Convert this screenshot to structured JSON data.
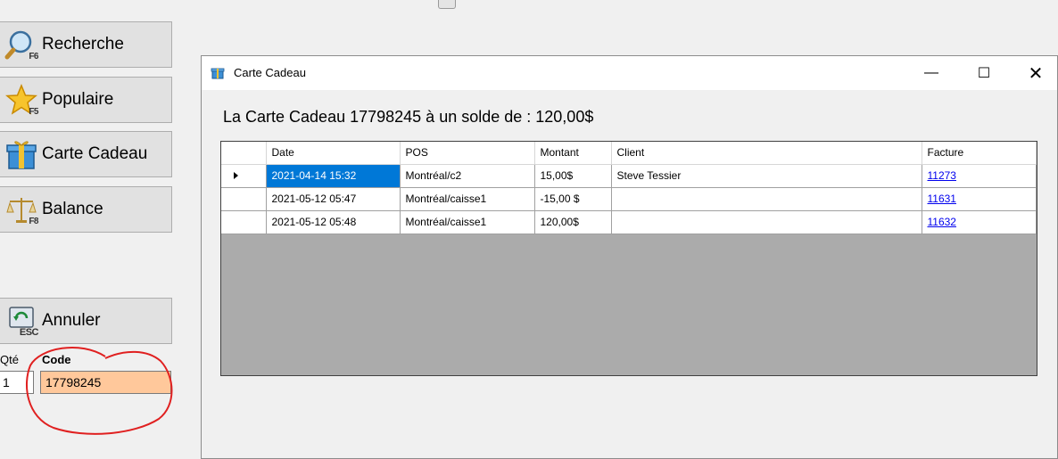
{
  "sidebar": {
    "buttons": [
      {
        "label": "Recherche",
        "key": "F6",
        "icon": "magnifier-icon"
      },
      {
        "label": "Populaire",
        "key": "F5",
        "icon": "star-icon"
      },
      {
        "label": "Carte Cadeau",
        "key": "",
        "icon": "gift-icon"
      },
      {
        "label": "Balance",
        "key": "F8",
        "icon": "scale-icon"
      },
      {
        "label": "Annuler",
        "key": "ESC",
        "icon": "cancel-icon"
      }
    ],
    "qty_label": "Qté",
    "qty_value": "1",
    "code_label": "Code",
    "code_value": "17798245"
  },
  "dialog": {
    "title": "Carte Cadeau",
    "controls": {
      "minimize": "—",
      "maximize": "☐",
      "close": "✕"
    },
    "balance_text": "La Carte Cadeau 17798245 à un solde de : 120,00$",
    "columns": [
      "Date",
      "POS",
      "Montant",
      "Client",
      "Facture"
    ],
    "rows": [
      {
        "date": "2021-04-14 15:32",
        "pos": "Montréal/c2",
        "montant": "15,00$",
        "client": "Steve Tessier",
        "facture": "11273"
      },
      {
        "date": "2021-05-12 05:47",
        "pos": "Montréal/caisse1",
        "montant": "-15,00 $",
        "client": "",
        "facture": "11631"
      },
      {
        "date": "2021-05-12 05:48",
        "pos": "Montréal/caisse1",
        "montant": "120,00$",
        "client": "",
        "facture": "11632"
      }
    ]
  },
  "colors": {
    "selection": "#0078d7",
    "code_highlight": "#ffc89b",
    "annotation": "#e02020",
    "link": "#0000ee"
  }
}
